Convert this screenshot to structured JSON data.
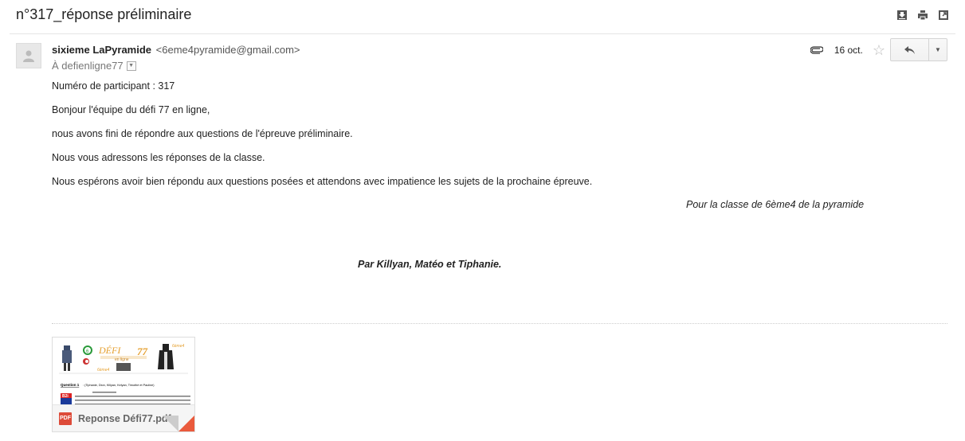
{
  "email": {
    "subject": "n°317_réponse préliminaire",
    "sender_name": "sixieme LaPyramide",
    "sender_email": "<6eme4pyramide@gmail.com>",
    "recipient": "À defienligne77",
    "date": "16 oct.",
    "body": {
      "line1": "Numéro de participant : 317",
      "line2": "Bonjour l'équipe du défi 77 en ligne,",
      "line3": "nous avons fini de répondre aux questions de l'épreuve préliminaire.",
      "line4": "Nous vous adressons les réponses de la classe.",
      "line5": "Nous espérons avoir bien répondu aux questions posées et attendons avec impatience les sujets de la prochaine épreuve.",
      "signature1": "Pour la classe de 6ème4 de la pyramide",
      "signature2": "Par Killyan, Matéo et Tiphanie."
    }
  },
  "attachment": {
    "file_name": "Reponse Défi77.pdf",
    "badge": "PDF",
    "thumbnail": {
      "title_letters": "DÉFI",
      "title_number": "77",
      "subtitle": "en ligne",
      "badge_text": "6ème4",
      "question_label": "Question 1",
      "question_names": ": (Tiphanie, Dion, Killyan, Kelyan, Timothé et Pauline)",
      "logo_text": "B2i"
    }
  },
  "icons": [
    "download-icon",
    "print-icon",
    "new-window-icon",
    "paperclip-icon",
    "star-icon",
    "reply-icon",
    "chevron-down-icon",
    "avatar-icon"
  ],
  "colors": {
    "pdf_red": "#dd4b39",
    "corner_red": "#ea5a3c"
  }
}
